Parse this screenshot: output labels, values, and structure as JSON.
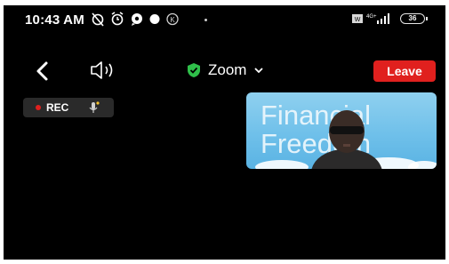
{
  "status_bar": {
    "time": "10:43 AM",
    "battery": "36",
    "signal_label": "4G+"
  },
  "meeting": {
    "title": "Zoom",
    "leave_label": "Leave",
    "rec_label": "REC",
    "accent_green": "#2fbf4a",
    "leave_color": "#e0201e"
  },
  "video_tile": {
    "background_text_line1": "Financial",
    "background_text_line2": "Freedom"
  },
  "icons": [
    "alarm-off-icon",
    "alarm-icon",
    "chat-icon",
    "circle-icon",
    "k-icon",
    "back-icon",
    "speaker-icon",
    "shield-check-icon",
    "chevron-down-icon",
    "mic-icon",
    "signal-icon",
    "battery-icon"
  ]
}
